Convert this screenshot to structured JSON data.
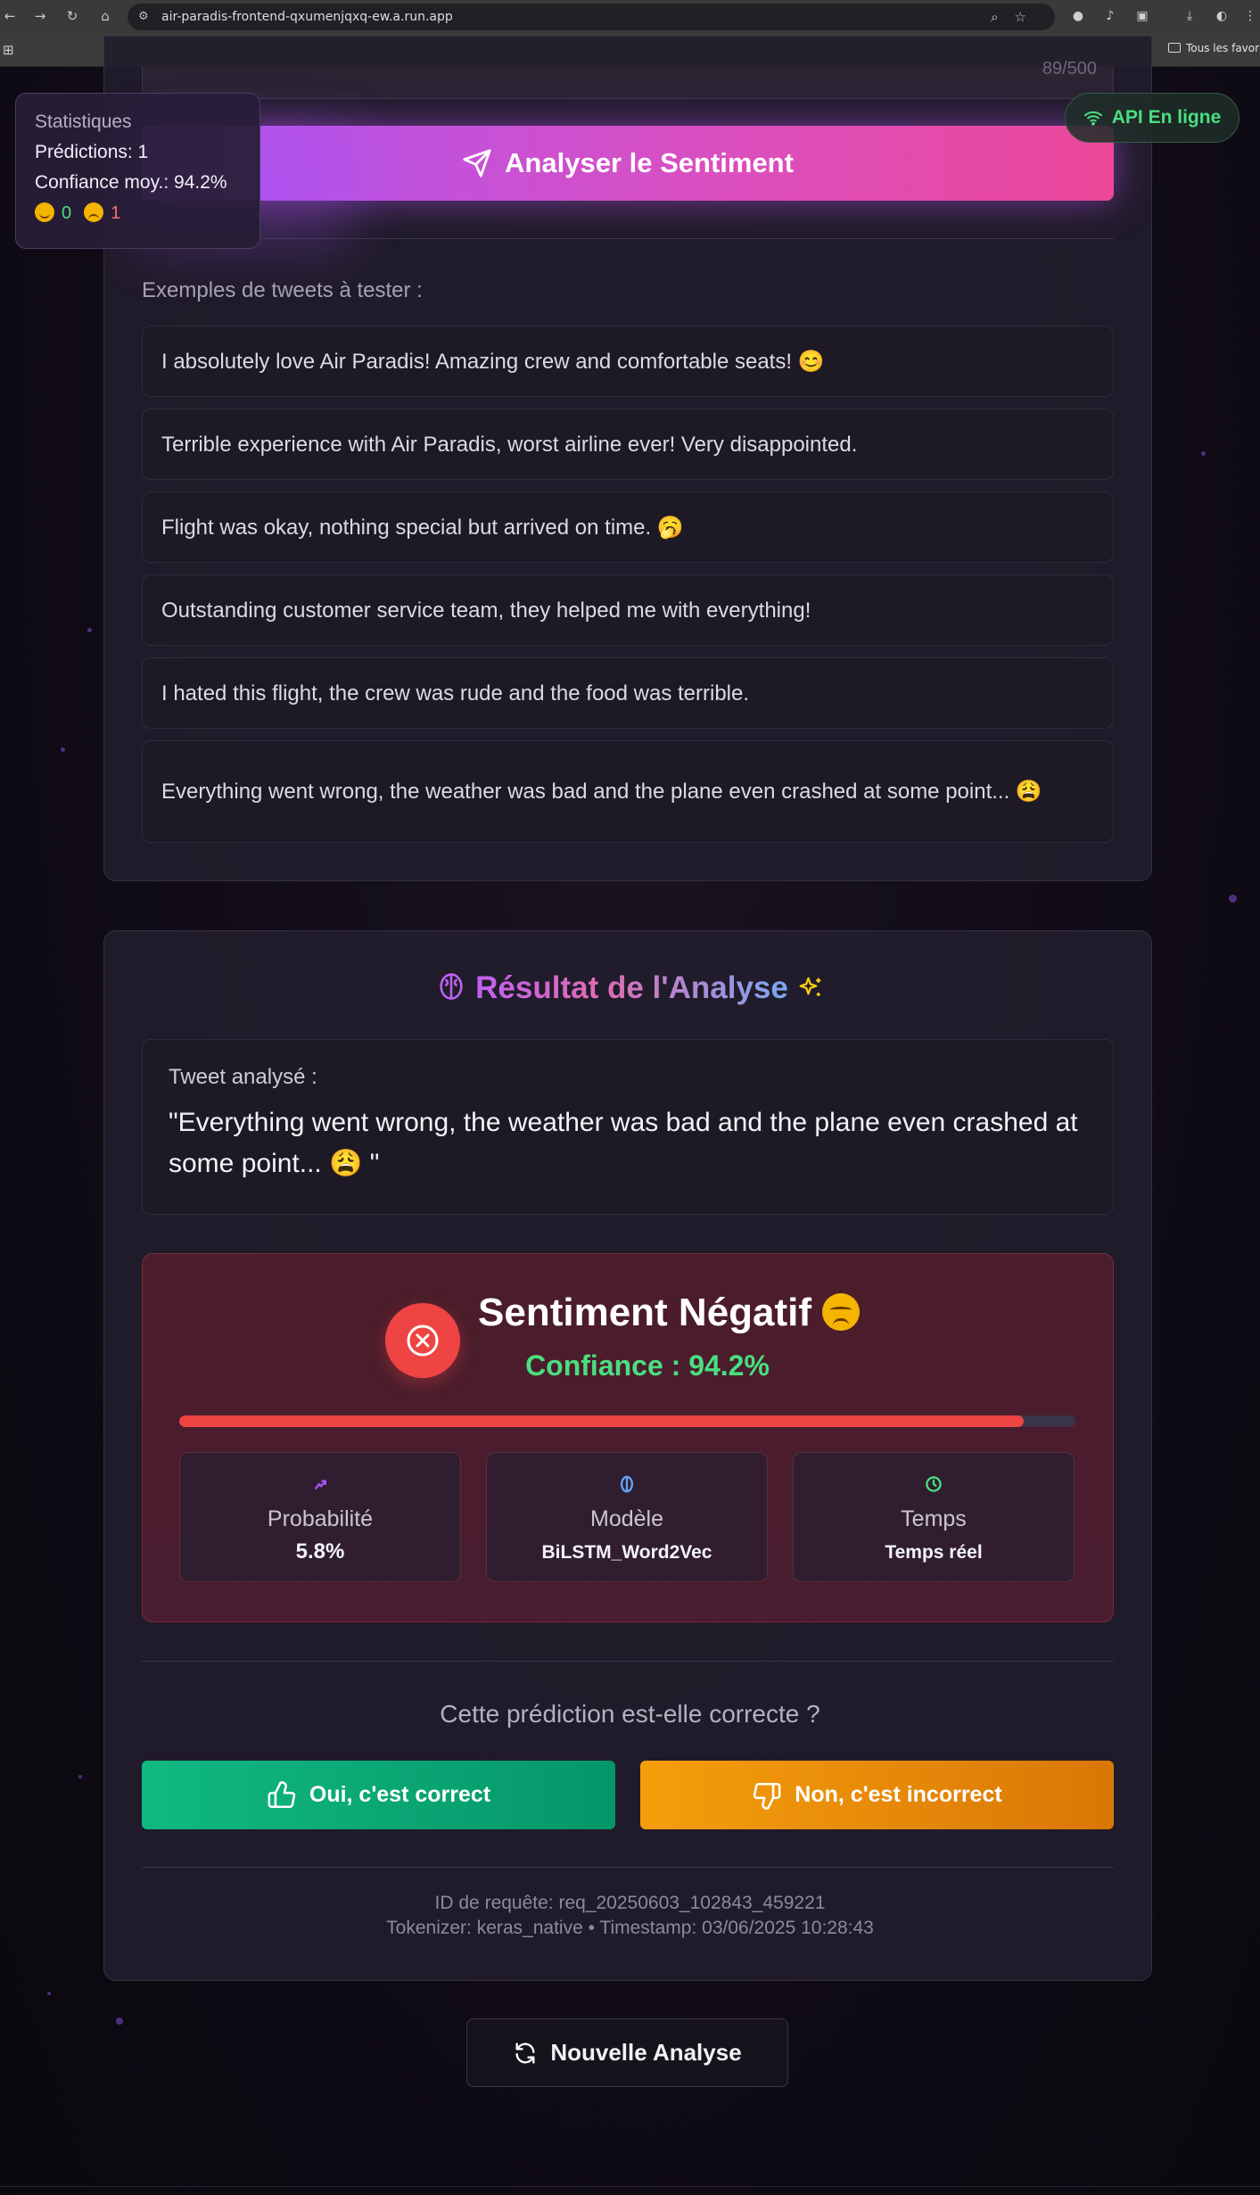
{
  "browser": {
    "url": "air-paradis-frontend-qxumenjqxq-ew.a.run.app",
    "bookmark_folder": "Tous les favoris"
  },
  "form": {
    "char_count": "89/500",
    "analyze_label": "Analyser le Sentiment",
    "examples_title": "Exemples de tweets à tester :",
    "examples": [
      "I absolutely love Air Paradis! Amazing crew and comfortable seats! 😊",
      "Terrible experience with Air Paradis, worst airline ever! Very disappointed.",
      "Flight was okay, nothing special but arrived on time. 🥱",
      "Outstanding customer service team, they helped me with everything!",
      "I hated this flight, the crew was rude and the food was terrible.",
      "Everything went wrong, the weather was bad and the plane even crashed at some point... 😩"
    ]
  },
  "stats": {
    "title": "Statistiques",
    "predictions": "Prédictions: 1",
    "confidence_avg": "Confiance moy.: 94.2%",
    "positive_count": "0",
    "negative_count": "1"
  },
  "api": {
    "status_label": "API En ligne",
    "status_color": "#4ade80"
  },
  "result": {
    "title_part1": "Résultat de l'",
    "title_part2": "Analyse",
    "tweet_label": "Tweet analysé :",
    "tweet_text": "\"Everything went wrong, the weather was bad and the plane even crashed at some point... 😩 \"",
    "sentiment_label": "Sentiment Négatif",
    "confidence_label": "Confiance : 94.2%",
    "confidence_value": 0.942,
    "metrics": [
      {
        "icon": "trending-up-icon",
        "label": "Probabilité",
        "value": "5.8%"
      },
      {
        "icon": "brain-icon",
        "label": "Modèle",
        "value": "BiLSTM_Word2Vec"
      },
      {
        "icon": "clock-icon",
        "label": "Temps",
        "value": "Temps réel"
      }
    ],
    "question": "Cette prédiction est-elle correcte ?",
    "yes_label": "Oui, c'est correct",
    "no_label": "Non, c'est incorrect",
    "request_id": "ID de requête: req_20250603_102843_459221",
    "tokenizer_line": "Tokenizer: keras_native • Timestamp: 03/06/2025 10:28:43"
  },
  "new_analysis_label": "Nouvelle Analyse",
  "colors": {
    "accent_purple": "#a855f7",
    "accent_pink": "#ec4899",
    "negative": "#ef4444",
    "positive": "#4ade80",
    "yes_button": "#10b981",
    "no_button": "#f59e0b"
  }
}
